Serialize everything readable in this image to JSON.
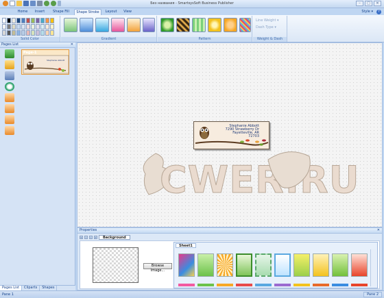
{
  "window": {
    "title": "Без названия - SmartsysSoft Business Publisher",
    "controls": [
      "–",
      "□",
      "✕"
    ]
  },
  "ribbon": {
    "tabs": [
      {
        "label": "Home"
      },
      {
        "label": "Insert"
      },
      {
        "label": "Shape Fill"
      },
      {
        "label": "Shape Stroke",
        "active": true
      },
      {
        "label": "Layout"
      },
      {
        "label": "View"
      }
    ],
    "style_menu": "Style ▾",
    "help": "?",
    "groups": {
      "solid_color": "Solid Color",
      "gradient": "Gradient",
      "pattern": "Pattern",
      "weight_dash": "Weight & Dash"
    },
    "line_weight": "Line Weight ▾",
    "dash_type": "Dash Type ▾"
  },
  "left_panel": {
    "title": "Pages List",
    "close": "✕",
    "page_label": "Page-1",
    "bottom_tabs": [
      {
        "label": "Pages List",
        "active": true
      },
      {
        "label": "Cliparts"
      },
      {
        "label": "Shapes"
      }
    ]
  },
  "canvas": {
    "label": {
      "name": "Stephanie Abbott",
      "line1": "7290 Strawberry Dr",
      "line2": "Fayetteville, AR",
      "line3": "72703"
    },
    "watermark": "CWER.RU"
  },
  "properties": {
    "title": "Properties",
    "close": "✕",
    "tab": "Background",
    "browse_button": "Browse Image...",
    "sheet_tab": "Sheet1"
  },
  "status": {
    "pane1": "Pane 1",
    "pane2": "Pane 2"
  }
}
